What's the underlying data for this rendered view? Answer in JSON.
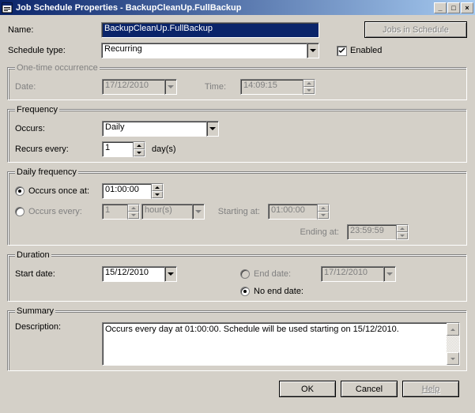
{
  "window": {
    "title": "Job Schedule Properties - BackupCleanUp.FullBackup"
  },
  "fields": {
    "name_label": "Name:",
    "name_value": "BackupCleanUp.FullBackup",
    "jobs_in_schedule_btn": "Jobs in Schedule",
    "schedule_type_label": "Schedule type:",
    "schedule_type_value": "Recurring",
    "enabled_label": "Enabled"
  },
  "onetime": {
    "legend": "One-time occurrence",
    "date_label": "Date:",
    "date_value": "17/12/2010",
    "time_label": "Time:",
    "time_value": "14:09:15"
  },
  "frequency": {
    "legend": "Frequency",
    "occurs_label": "Occurs:",
    "occurs_value": "Daily",
    "recurs_label": "Recurs every:",
    "recurs_value": "1",
    "recurs_unit": "day(s)"
  },
  "daily": {
    "legend": "Daily frequency",
    "occurs_once_label": "Occurs once at:",
    "occurs_once_value": "01:00:00",
    "occurs_every_label": "Occurs every:",
    "occurs_every_value": "1",
    "occurs_every_unit": "hour(s)",
    "starting_label": "Starting at:",
    "starting_value": "01:00:00",
    "ending_label": "Ending at:",
    "ending_value": "23:59:59"
  },
  "duration": {
    "legend": "Duration",
    "start_label": "Start date:",
    "start_value": "15/12/2010",
    "end_date_label": "End date:",
    "end_date_value": "17/12/2010",
    "no_end_label": "No end date:"
  },
  "summary": {
    "legend": "Summary",
    "desc_label": "Description:",
    "desc_value": "Occurs every day at 01:00:00. Schedule will be used starting on 15/12/2010."
  },
  "footer": {
    "ok": "OK",
    "cancel": "Cancel",
    "help": "Help"
  }
}
